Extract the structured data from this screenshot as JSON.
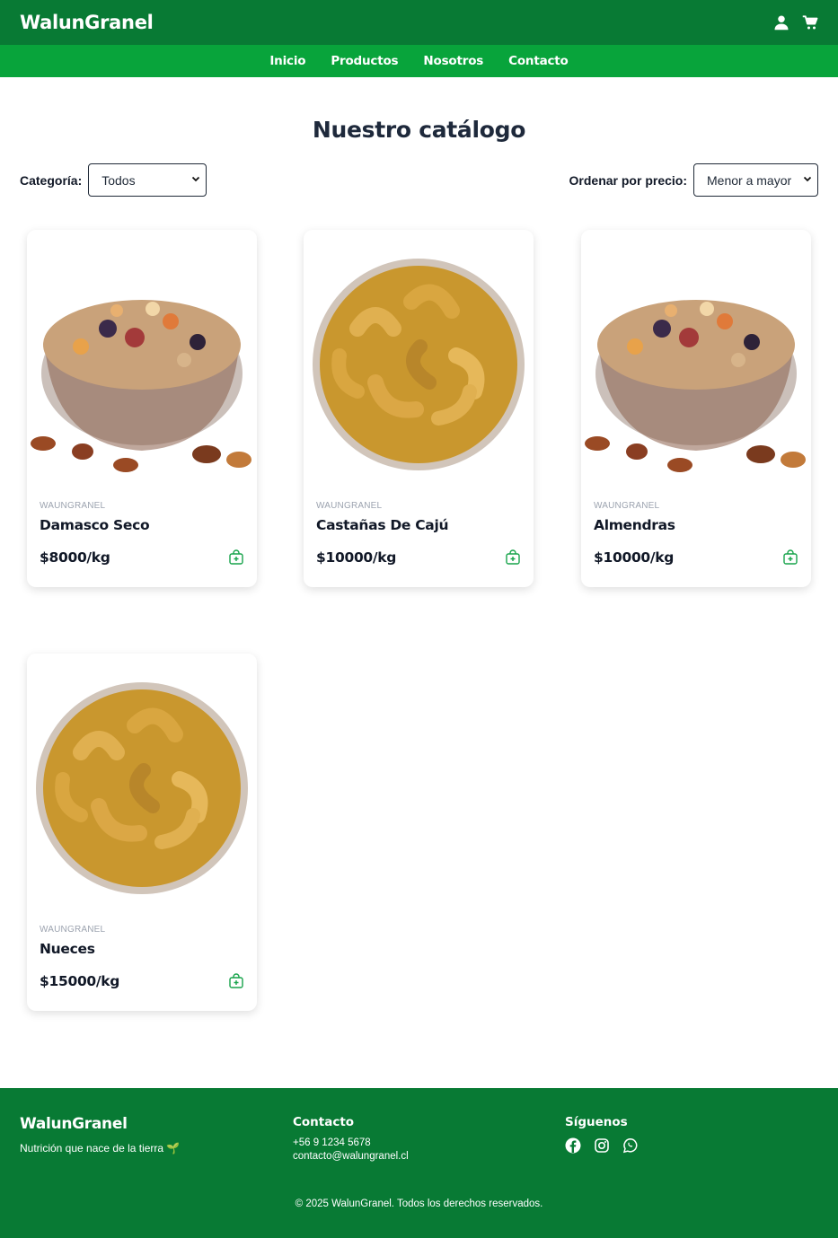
{
  "header": {
    "brand": "WalunGranel",
    "icons": [
      "user-icon",
      "cart-icon"
    ]
  },
  "nav": {
    "items": [
      "Inicio",
      "Productos",
      "Nosotros",
      "Contacto"
    ]
  },
  "page": {
    "title": "Nuestro catálogo"
  },
  "filters": {
    "category_label": "Categoría:",
    "category_value": "Todos",
    "sort_label": "Ordenar por precio:",
    "sort_value": "Menor a mayor"
  },
  "products": [
    {
      "brand": "WAUNGRANEL",
      "name": "Damasco Seco",
      "price": "$8000/kg",
      "image": "mixed-nuts-bowl"
    },
    {
      "brand": "WAUNGRANEL",
      "name": "Castañas De Cajú",
      "price": "$10000/kg",
      "image": "cashew-bowl"
    },
    {
      "brand": "WAUNGRANEL",
      "name": "Almendras",
      "price": "$10000/kg",
      "image": "mixed-nuts-bowl"
    },
    {
      "brand": "WAUNGRANEL",
      "name": "Nueces",
      "price": "$15000/kg",
      "image": "cashew-bowl"
    }
  ],
  "footer": {
    "brand": "WalunGranel",
    "tagline": "Nutrición que nace de la tierra 🌱",
    "contact_heading": "Contacto",
    "phone": "+56 9 1234 5678",
    "email": "contacto@walungranel.cl",
    "social_heading": "Síguenos",
    "social_icons": [
      "facebook-icon",
      "instagram-icon",
      "whatsapp-icon"
    ],
    "copyright": "© 2025 WalunGranel. Todos los derechos reservados."
  },
  "colors": {
    "header": "#087a34",
    "nav": "#08a43b",
    "accent": "#16a34a",
    "footer": "#087a34"
  }
}
